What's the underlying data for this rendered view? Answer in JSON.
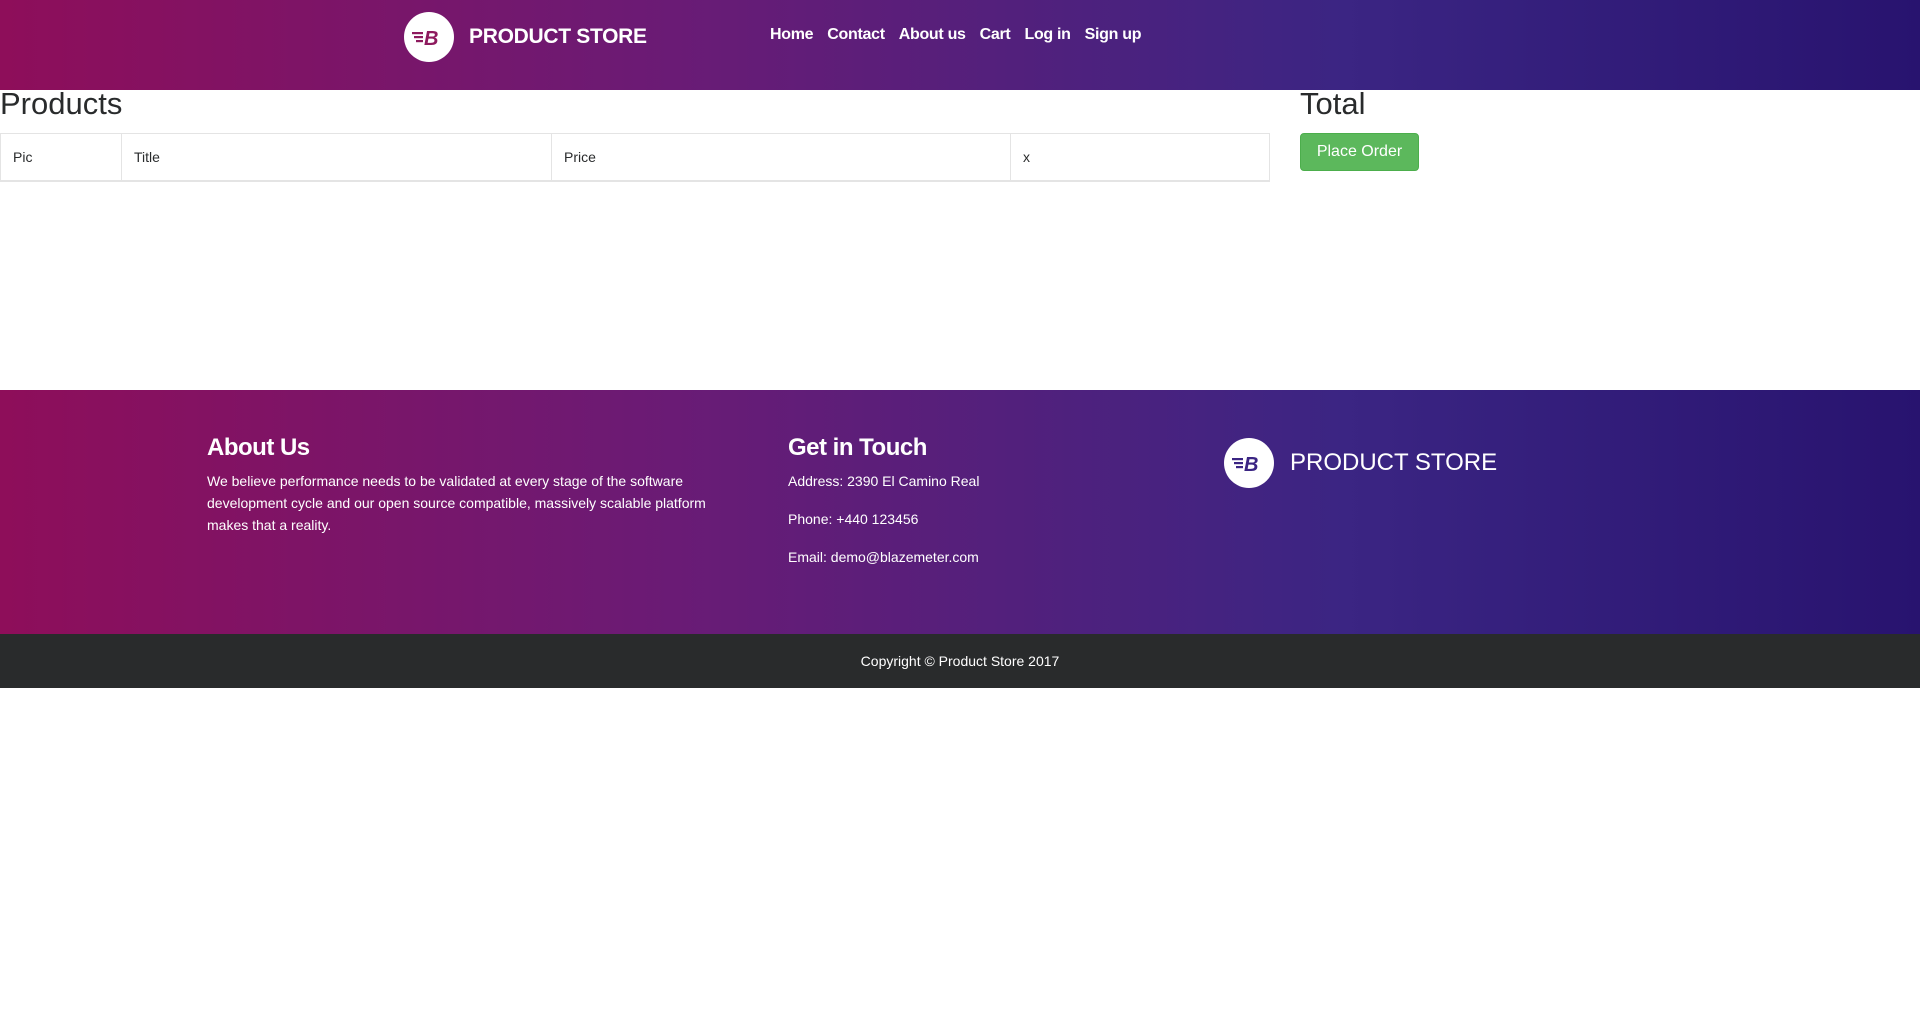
{
  "navbar": {
    "brand": "PRODUCT STORE",
    "links": [
      "Home",
      "Contact",
      "About us",
      "Cart",
      "Log in",
      "Sign up"
    ]
  },
  "cart": {
    "products_title": "Products",
    "columns": [
      "Pic",
      "Title",
      "Price",
      "x"
    ],
    "rows": [],
    "total_title": "Total",
    "place_order_label": "Place Order"
  },
  "footer": {
    "about_title": "About Us",
    "about_text": "We believe performance needs to be validated at every stage of the software development cycle and our open source compatible, massively scalable platform makes that a reality.",
    "contact_title": "Get in Touch",
    "address": "Address: 2390 El Camino Real",
    "phone": "Phone: +440 123456",
    "email": "Email: demo@blazemeter.com",
    "brand": "PRODUCT STORE",
    "copyright": "Copyright © Product Store 2017"
  },
  "colors": {
    "gradient_start": "#8e0e5a",
    "gradient_end": "#28136f",
    "place_order": "#5cb85c",
    "copyright_bg": "#292b2c"
  },
  "icons": {
    "logo": "blazemeter-logo-icon"
  }
}
